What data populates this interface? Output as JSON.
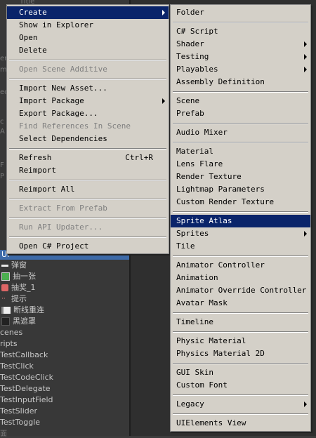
{
  "main_menu": {
    "items": [
      {
        "label": "Create",
        "submenu": true,
        "highlight": true
      },
      {
        "label": "Show in Explorer"
      },
      {
        "label": "Open"
      },
      {
        "label": "Delete"
      },
      {
        "label": "Open Scene Additive",
        "disabled": true
      },
      {
        "label": "Import New Asset..."
      },
      {
        "label": "Import Package",
        "submenu": true
      },
      {
        "label": "Export Package..."
      },
      {
        "label": "Find References In Scene",
        "disabled": true
      },
      {
        "label": "Select Dependencies"
      },
      {
        "label": "Refresh",
        "shortcut": "Ctrl+R"
      },
      {
        "label": "Reimport"
      },
      {
        "label": "Reimport All"
      },
      {
        "label": "Extract From Prefab",
        "disabled": true
      },
      {
        "label": "Run API Updater...",
        "disabled": true
      },
      {
        "label": "Open C# Project"
      }
    ]
  },
  "sub_menu": {
    "items": [
      {
        "label": "Folder"
      },
      {
        "label": "C# Script"
      },
      {
        "label": "Shader",
        "submenu": true
      },
      {
        "label": "Testing",
        "submenu": true
      },
      {
        "label": "Playables",
        "submenu": true
      },
      {
        "label": "Assembly Definition"
      },
      {
        "label": "Scene"
      },
      {
        "label": "Prefab"
      },
      {
        "label": "Audio Mixer"
      },
      {
        "label": "Material"
      },
      {
        "label": "Lens Flare"
      },
      {
        "label": "Render Texture"
      },
      {
        "label": "Lightmap Parameters"
      },
      {
        "label": "Custom Render Texture"
      },
      {
        "label": "Sprite Atlas",
        "highlight": true
      },
      {
        "label": "Sprites",
        "submenu": true
      },
      {
        "label": "Tile"
      },
      {
        "label": "Animator Controller"
      },
      {
        "label": "Animation"
      },
      {
        "label": "Animator Override Controller"
      },
      {
        "label": "Avatar Mask"
      },
      {
        "label": "Timeline"
      },
      {
        "label": "Physic Material"
      },
      {
        "label": "Physics Material 2D"
      },
      {
        "label": "GUI Skin"
      },
      {
        "label": "Custom Font"
      },
      {
        "label": "Legacy",
        "submenu": true
      },
      {
        "label": "UIElements View"
      }
    ]
  },
  "hierarchy": {
    "selected_label": "UI",
    "children": [
      "弹窗",
      "抽一张",
      "抽奖_1",
      "提示",
      "断线重连",
      "黑遮罩"
    ],
    "folders": [
      "cenes",
      "ripts"
    ],
    "scripts": [
      "TestCallback",
      "TestClick",
      "TestCodeClick",
      "TestDelegate",
      "TestInputField",
      "TestSlider",
      "TestToggle"
    ],
    "ghost_text": [
      "Title",
      "er",
      "m",
      "ec",
      "c",
      "A",
      "F",
      "P",
      "面"
    ]
  }
}
